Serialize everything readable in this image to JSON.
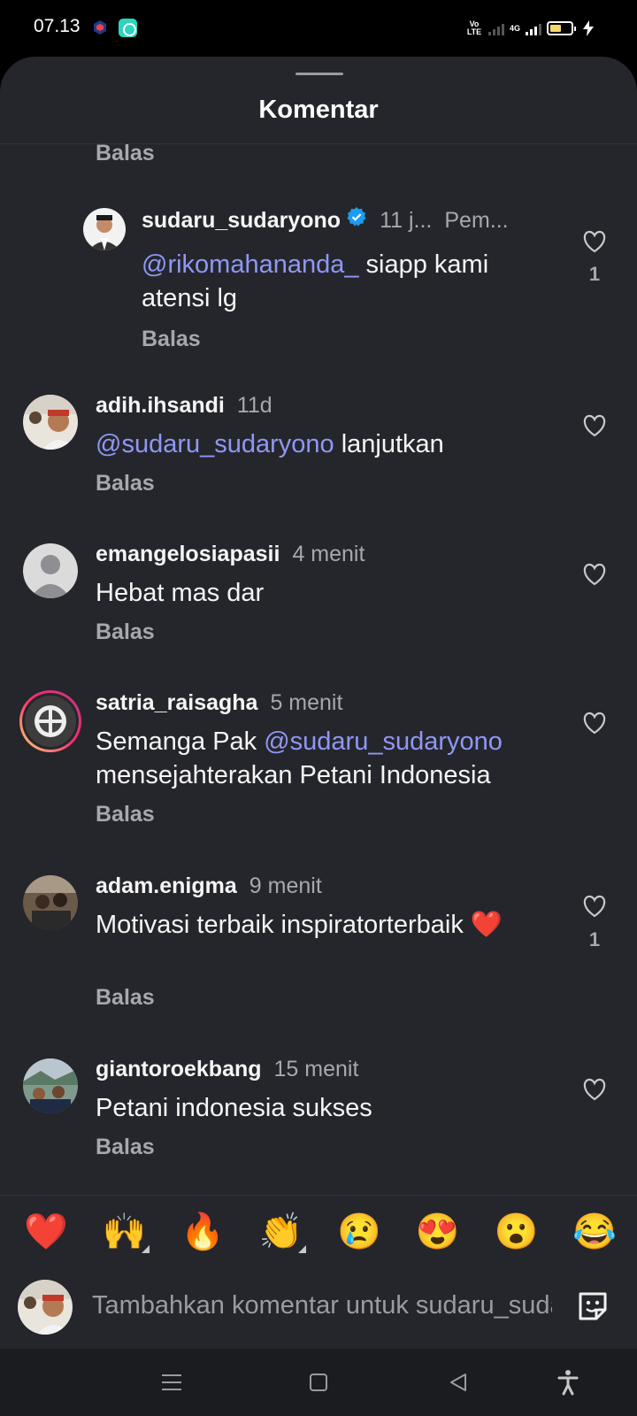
{
  "status_bar": {
    "time": "07.13",
    "volte_label": "Vo LTE",
    "network_label": "4G",
    "battery_level": 0.45
  },
  "sheet": {
    "title": "Komentar"
  },
  "reply_label": "Balas",
  "comments": [
    {
      "username": "sudaru_sudaryono",
      "verified": true,
      "time": "11 j...",
      "extra": "Pem...",
      "mention": "@rikomahananda_",
      "text": " siapp kami atensi lg",
      "likes": "1",
      "is_reply": true
    },
    {
      "username": "adih.ihsandi",
      "time": "11d",
      "mention": "@sudaru_sudaryono",
      "text": " lanjutkan",
      "likes": ""
    },
    {
      "username": "emangelosiapasii",
      "time": "4 menit",
      "text": "Hebat mas dar",
      "likes": ""
    },
    {
      "username": "satria_raisagha",
      "time": "5 menit",
      "text_before": "Semanga Pak ",
      "mention": "@sudaru_sudaryono",
      "text": " mensejahterakan Petani Indonesia",
      "likes": ""
    },
    {
      "username": "adam.enigma",
      "time": "9 menit",
      "text": "Motivasi terbaik inspiratorterbaik ❤️",
      "likes": "1"
    },
    {
      "username": "giantoroekbang",
      "time": "15 menit",
      "text": "Petani indonesia sukses",
      "likes": ""
    }
  ],
  "emoji_bar": [
    "❤️",
    "🙌",
    "🔥",
    "👏",
    "😢",
    "😍",
    "😮",
    "😂"
  ],
  "composer": {
    "placeholder": "Tambahkan komentar untuk sudaru_sudaryono..."
  },
  "icons": {
    "heart": "heart-outline-icon",
    "verified": "verified-badge-icon",
    "sticker": "sticker-icon",
    "nav_menu": "menu-icon",
    "nav_home": "home-square-icon",
    "nav_back": "back-triangle-icon",
    "accessibility": "accessibility-icon"
  },
  "colors": {
    "sheet_bg": "#25262b",
    "mention": "#8f97f7",
    "muted": "#a6a8ad",
    "verified": "#1d9bf0"
  }
}
